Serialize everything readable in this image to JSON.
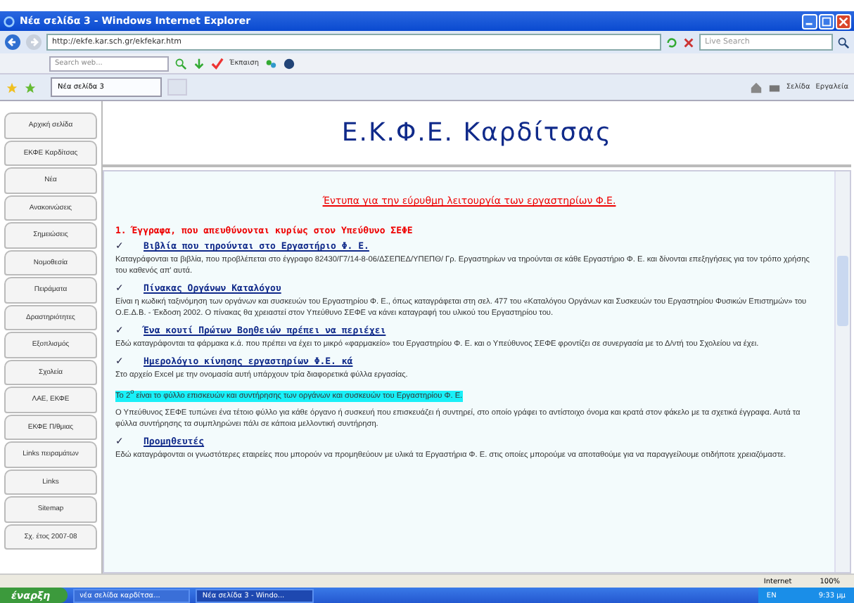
{
  "window": {
    "title": "Νέα σελίδα 3 - Windows Internet Explorer"
  },
  "address_bar": {
    "url": "http://ekfe.kar.sch.gr/ekfekar.htm",
    "search_placeholder": "Live Search"
  },
  "toolbar": {
    "search_placeholder": "Search web...",
    "button": "Έκπαιση"
  },
  "tabs": [
    {
      "label": "Νέα σελίδα 3",
      "selected": true
    }
  ],
  "command_bar": [
    "Σελίδα",
    "Εργαλεία"
  ],
  "sidebar": {
    "items": [
      {
        "label": "Αρχική σελίδα"
      },
      {
        "label": "ΕΚΦΕ Καρδίτσας"
      },
      {
        "label": "Νέα"
      },
      {
        "label": "Ανακοινώσεις"
      },
      {
        "label": "Σημειώσεις"
      },
      {
        "label": "Νομοθεσία"
      },
      {
        "label": "Πειράματα"
      },
      {
        "label": "Δραστηριότητες"
      },
      {
        "label": "Εξοπλισμός"
      },
      {
        "label": "Σχολεία"
      },
      {
        "label": "ΛΑΕ, ΕΚΦΕ"
      },
      {
        "label": "ΕΚΦΕ Π/θμιας"
      },
      {
        "label": "Links πειραμάτων"
      },
      {
        "label": "Links"
      },
      {
        "label": "Sitemap"
      },
      {
        "label": "Σχ. έτος 2007-08"
      }
    ]
  },
  "page": {
    "heading": "Ε.Κ.Φ.Ε. Καρδίτσας",
    "subtitle": "Έντυπα για την εύρυθμη λειτουργία των εργαστηρίων Φ.Ε.",
    "section": "1. Έγγραφα, που απευθύνονται κυρίως στον Υπεύθυνο ΣΕΦΕ",
    "blocks": [
      {
        "kind": "heading",
        "mark": "✓",
        "text": "Βιβλία που τηρούνται στο Εργαστήριο Φ. Ε."
      },
      {
        "kind": "para",
        "text": "Καταγράφονται τα βιβλία, που προβλέπεται στο έγγραφο 82430/Γ7/14-8-06/ΔΣΕΠΕΔ/ΥΠΕΠΘ/ Γρ. Εργαστηρίων να τηρούνται σε κάθε Εργαστήριο Φ. Ε. και δίνονται επεξηγήσεις για τον τρόπο χρήσης του καθενός απ' αυτά."
      },
      {
        "kind": "heading",
        "mark": "✓",
        "text": "Πίνακας Οργάνων Καταλόγου"
      },
      {
        "kind": "para",
        "text": "Είναι η κωδική ταξινόμηση των οργάνων και συσκευών του Εργαστηρίου Φ. Ε., όπως καταγράφεται στη σελ. 477 του «Καταλόγου Οργάνων και Συσκευών του Εργαστηρίου Φυσικών Επιστημών» του Ο.Ε.Δ.Β. - Έκδοση 2002. Ο πίνακας θα χρειαστεί στον Υπεύθυνο ΣΕΦΕ να κάνει καταγραφή του υλικού του Εργαστηρίου του."
      },
      {
        "kind": "heading",
        "mark": "✓",
        "text": "Ένα κουτί Πρώτων Βοηθειών πρέπει να περιέχει"
      },
      {
        "kind": "para",
        "text": "Εδώ καταγράφονται τα φάρμακα κ.ά. που πρέπει να έχει το μικρό «φαρμακείο» του Εργαστηρίου Φ. Ε. και ο Υπεύθυνος ΣΕΦΕ φροντίζει σε συνεργασία με το Δ/ντή του Σχολείου να έχει."
      },
      {
        "kind": "heading",
        "mark": "✓",
        "text": "Ημερολόγιο κίνησης εργαστηρίων Φ.Ε. κά"
      },
      {
        "kind": "para",
        "text": "Στο αρχείο Excel με την ονομασία αυτή υπάρχουν τρία διαφορετικά φύλλα εργασίας."
      },
      {
        "kind": "highlight",
        "text": "Το 2$^{ο}$ είναι το φύλλο επισκευών και συντήρησης των οργάνων και συσκευών του Εργαστηρίου Φ. Ε."
      },
      {
        "kind": "para",
        "text": "Ο Υπεύθυνος ΣΕΦΕ τυπώνει ένα τέτοιο φύλλο για κάθε όργανο ή συσκευή που επισκευάζει ή συντηρεί, στο οποίο γράφει το αντίστοιχο όνομα και κρατά στον φάκελο με τα σχετικά έγγραφα. Αυτά τα φύλλα συντήρησης τα συμπληρώνει πάλι σε κάποια μελλοντική συντήρηση."
      },
      {
        "kind": "heading",
        "mark": "✓",
        "text": "Προμηθευτές"
      },
      {
        "kind": "para",
        "text": "Εδώ καταγράφονται οι γνωστότερες εταιρείες που μπορούν να προμηθεύουν με υλικά τα Εργαστήρια Φ. Ε. στις οποίες μπορούμε να αποταθούμε για να παραγγείλουμε οτιδήποτε χρειαζόμαστε."
      }
    ]
  },
  "status_bar": {
    "zone": "Internet",
    "zoom": "100%"
  },
  "taskbar": {
    "start": "έναρξη",
    "tasks": [
      {
        "label": "νέα σελίδα καρδίτσα...",
        "selected": false
      },
      {
        "label": "Νέα σελίδα 3 - Windo...",
        "selected": true
      }
    ],
    "lang": "EN",
    "clock": "9:33 μμ"
  }
}
